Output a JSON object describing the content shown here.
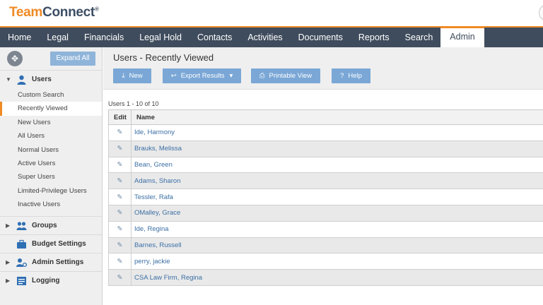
{
  "app": {
    "logo_team": "Team",
    "logo_connect": "Connect",
    "logo_reg": "®"
  },
  "nav": {
    "items": [
      "Home",
      "Legal",
      "Financials",
      "Legal Hold",
      "Contacts",
      "Activities",
      "Documents",
      "Reports",
      "Search",
      "Admin"
    ],
    "active": "Admin"
  },
  "sidebar": {
    "expand_all": "Expand All",
    "users": {
      "label": "Users",
      "items": [
        "Custom Search",
        "Recently Viewed",
        "New Users",
        "All Users",
        "Normal Users",
        "Active Users",
        "Super Users",
        "Limited-Privilege Users",
        "Inactive Users"
      ],
      "active": "Recently Viewed"
    },
    "sections": [
      "Groups",
      "Budget Settings",
      "Admin Settings",
      "Logging"
    ]
  },
  "main": {
    "title": "Users - Recently Viewed",
    "toolbar": {
      "new": "New",
      "export": "Export Results",
      "print": "Printable View",
      "help": "Help"
    },
    "count": "Users 1 - 10 of 10",
    "columns": [
      "Edit",
      "Name"
    ],
    "rows": [
      "Ide, Harmony",
      "Brauks, Melissa",
      "Bean, Green",
      "Adams, Sharon",
      "Tessler, Rafa",
      "OMalley, Grace",
      "Ide, Regina",
      "Barnes, Russell",
      "perry, jackie",
      "CSA Law Firm, Regina"
    ]
  },
  "colors": {
    "accent": "#f08a24",
    "nav_bg": "#3f4c5d",
    "button": "#7aa7d6",
    "link": "#3b6fa5"
  }
}
